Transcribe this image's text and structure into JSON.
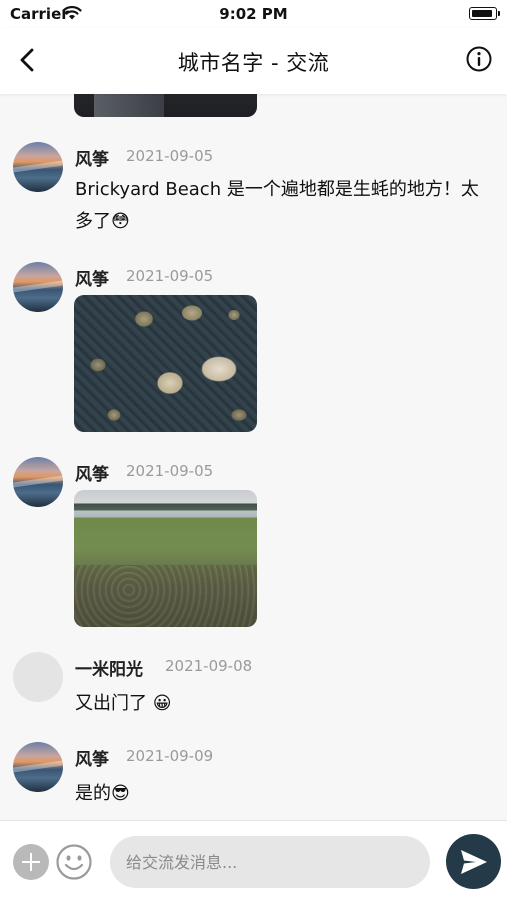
{
  "status_bar": {
    "carrier": "Carrier",
    "time": "9:02 PM"
  },
  "nav": {
    "title": "城市名字 - 交流"
  },
  "messages": [
    {
      "sender": "风筝",
      "date": "2021-09-05",
      "text": "Brickyard Beach 是一个遍地都是生蚝的地方！太多了😳"
    },
    {
      "sender": "风筝",
      "date": "2021-09-05",
      "image": "oyster-photo"
    },
    {
      "sender": "风筝",
      "date": "2021-09-05",
      "image": "beach-photo"
    },
    {
      "sender": "一米阳光",
      "date": "2021-09-08",
      "text": "又出门了 😀"
    },
    {
      "sender": "风筝",
      "date": "2021-09-09",
      "text": "是的😎"
    }
  ],
  "composer": {
    "placeholder": "给交流发消息..."
  },
  "colors": {
    "send_button": "#243a48",
    "input_background": "#e6e6e6",
    "background": "#f7f7f7"
  }
}
